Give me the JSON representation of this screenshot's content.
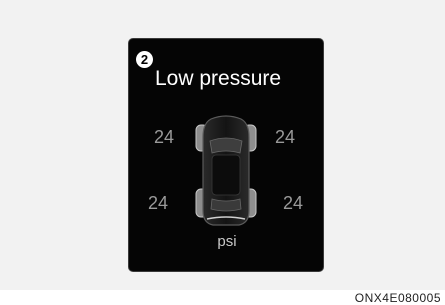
{
  "screen": {
    "marker": "2",
    "title": "Low pressure",
    "tires": {
      "front_left": "24",
      "front_right": "24",
      "rear_left": "24",
      "rear_right": "24"
    },
    "unit": "psi"
  },
  "figure_code": "ONX4E080005"
}
